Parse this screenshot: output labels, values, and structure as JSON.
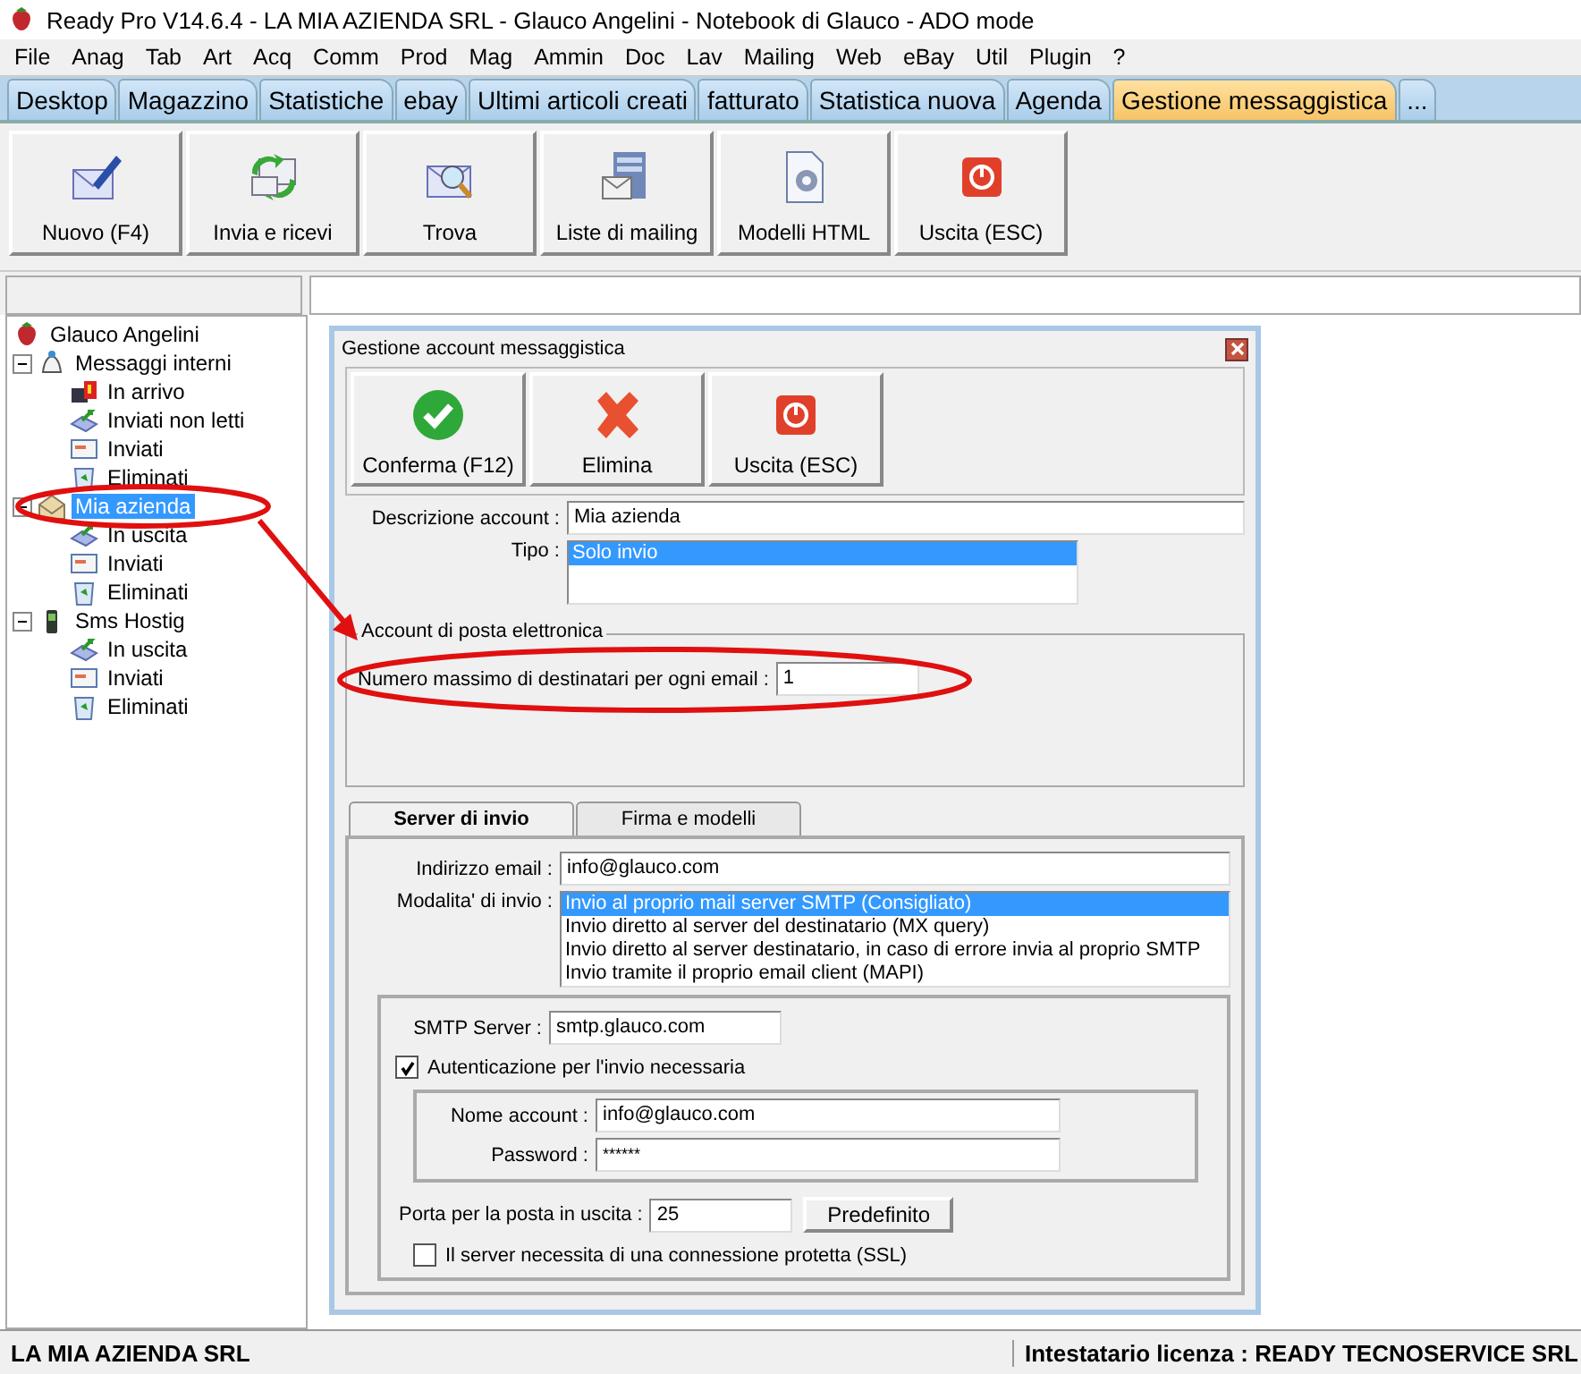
{
  "window": {
    "title": "Ready Pro V14.6.4 - LA MIA AZIENDA SRL - Glauco Angelini - Notebook di Glauco - ADO mode"
  },
  "menu": [
    "File",
    "Anag",
    "Tab",
    "Art",
    "Acq",
    "Comm",
    "Prod",
    "Mag",
    "Ammin",
    "Doc",
    "Lav",
    "Mailing",
    "Web",
    "eBay",
    "Util",
    "Plugin",
    "?"
  ],
  "tabs": [
    {
      "label": "Desktop",
      "selected": false
    },
    {
      "label": "Magazzino",
      "selected": false
    },
    {
      "label": "Statistiche",
      "selected": false
    },
    {
      "label": "ebay",
      "selected": false
    },
    {
      "label": "Ultimi articoli creati",
      "selected": false
    },
    {
      "label": "fatturato",
      "selected": false
    },
    {
      "label": "Statistica nuova",
      "selected": false
    },
    {
      "label": "Agenda",
      "selected": false
    },
    {
      "label": "Gestione messaggistica",
      "selected": true
    },
    {
      "label": "...",
      "selected": false
    }
  ],
  "toolbar": [
    {
      "label": "Nuovo (F4)",
      "kind": "new"
    },
    {
      "label": "Invia e ricevi",
      "kind": "sync"
    },
    {
      "label": "Trova",
      "kind": "find"
    },
    {
      "label": "Liste di mailing",
      "kind": "list"
    },
    {
      "label": "Modelli HTML",
      "kind": "template"
    },
    {
      "label": "Uscita (ESC)",
      "kind": "exit"
    }
  ],
  "tree": {
    "label": "Glauco Angelini",
    "children": [
      {
        "label": "Messaggi interni",
        "kind": "messages",
        "selected": false,
        "children": [
          {
            "label": "In arrivo",
            "kind": "inbox",
            "selected": false
          },
          {
            "label": "Inviati non letti",
            "kind": "outbox",
            "selected": false
          },
          {
            "label": "Inviati",
            "kind": "sent",
            "selected": false
          },
          {
            "label": "Eliminati",
            "kind": "trash",
            "selected": false
          }
        ]
      },
      {
        "label": "Mia azienda",
        "kind": "account",
        "selected": true,
        "children": [
          {
            "label": "In uscita",
            "kind": "outbox",
            "selected": false
          },
          {
            "label": "Inviati",
            "kind": "sent",
            "selected": false
          },
          {
            "label": "Eliminati",
            "kind": "trash",
            "selected": false
          }
        ]
      },
      {
        "label": "Sms Hostig",
        "kind": "phone",
        "selected": false,
        "children": [
          {
            "label": "In uscita",
            "kind": "outbox",
            "selected": false
          },
          {
            "label": "Inviati",
            "kind": "sent",
            "selected": false
          },
          {
            "label": "Eliminati",
            "kind": "trash",
            "selected": false
          }
        ]
      }
    ]
  },
  "dialog": {
    "title": "Gestione account messaggistica",
    "buttons": [
      {
        "label": "Conferma (F12)",
        "kind": "confirm"
      },
      {
        "label": "Elimina",
        "kind": "delete"
      },
      {
        "label": "Uscita (ESC)",
        "kind": "exit"
      }
    ],
    "description": {
      "label": "Descrizione account :",
      "value": "Mia azienda"
    },
    "type": {
      "label": "Tipo :",
      "options": [
        {
          "label": "Solo invio",
          "selected": true
        }
      ]
    },
    "group": {
      "title": "Account di posta elettronica",
      "max_label": "Numero massimo di destinatari per ogni email :",
      "max_value": "1"
    },
    "tabs": [
      {
        "label": "Server di invio",
        "selected": true
      },
      {
        "label": "Firma e modelli",
        "selected": false
      }
    ],
    "email": {
      "label": "Indirizzo email :",
      "value": "info@glauco.com"
    },
    "mode": {
      "label": "Modalita' di invio :",
      "options": [
        {
          "label": "Invio al proprio mail server SMTP (Consigliato)",
          "selected": true
        },
        {
          "label": "Invio diretto al server del destinatario (MX query)",
          "selected": false
        },
        {
          "label": "Invio diretto al server destinatario, in caso di errore invia al proprio SMTP",
          "selected": false
        },
        {
          "label": "Invio tramite il proprio email client (MAPI)",
          "selected": false
        }
      ]
    },
    "smtp": {
      "label": "SMTP Server :",
      "value": "smtp.glauco.com"
    },
    "auth": {
      "label": "Autenticazione per l'invio necessaria",
      "checked": true
    },
    "account": {
      "label": "Nome account :",
      "value": "info@glauco.com"
    },
    "password": {
      "label": "Password :",
      "value": "******"
    },
    "port": {
      "label": "Porta per la posta in uscita :",
      "value": "25",
      "button": "Predefinito"
    },
    "ssl": {
      "label": "Il server necessita di una connessione protetta (SSL)",
      "checked": false
    }
  },
  "status_bar": {
    "left": "LA MIA AZIENDA SRL",
    "right": "Intestatario licenza : READY TECNOSERVICE SRL"
  }
}
